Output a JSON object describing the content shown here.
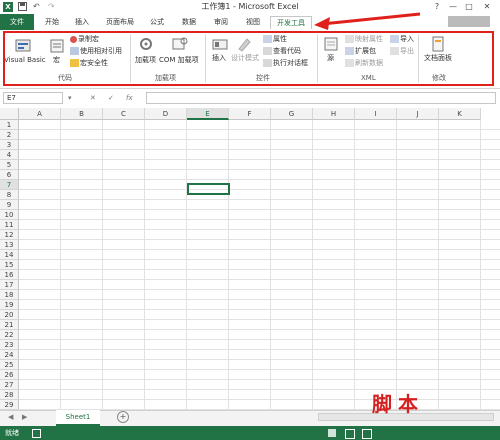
{
  "window": {
    "title": "工作簿1 - Microsoft Excel",
    "logo": "X",
    "minimize": "—",
    "restore": "□",
    "close": "✕",
    "help": "?"
  },
  "qat": {
    "save_icon": "save-icon",
    "undo": "↶",
    "redo": "↷"
  },
  "tabs": [
    "文件",
    "开始",
    "插入",
    "页面布局",
    "公式",
    "数据",
    "审阅",
    "视图",
    "开发工具"
  ],
  "active_tab": "开发工具",
  "ribbon": {
    "groups": [
      {
        "label": "代码",
        "items": [
          "Visual Basic",
          "宏",
          "录制宏",
          "使用相对引用",
          "宏安全性"
        ]
      },
      {
        "label": "加载项",
        "items": [
          "加载项",
          "COM 加载项"
        ]
      },
      {
        "label": "控件",
        "items": [
          "插入",
          "设计模式",
          "属性",
          "查看代码",
          "执行对话框"
        ]
      },
      {
        "label": "XML",
        "items": [
          "源",
          "映射属性",
          "扩展包",
          "刷新数据",
          "导入",
          "导出"
        ]
      },
      {
        "label": "修改",
        "items": [
          "文档面板"
        ]
      }
    ]
  },
  "formula_bar": {
    "name_box": "E7",
    "cancel": "✕",
    "enter": "✓",
    "fx": "fx",
    "value": ""
  },
  "columns": [
    "A",
    "B",
    "C",
    "D",
    "E",
    "F",
    "G",
    "H",
    "I",
    "J",
    "K"
  ],
  "selected_column": "E",
  "rows": [
    "1",
    "2",
    "3",
    "4",
    "5",
    "6",
    "7",
    "8",
    "9",
    "10",
    "11",
    "12",
    "13",
    "14",
    "15",
    "16",
    "17",
    "18",
    "19",
    "20",
    "21",
    "22",
    "23",
    "24",
    "25",
    "26",
    "27",
    "28",
    "29"
  ],
  "selected_row": "7",
  "sheets": {
    "tabs": [
      "Sheet1"
    ],
    "add": "+",
    "prev": "◀",
    "next": "▶"
  },
  "status": {
    "text": "就绪"
  },
  "watermark": "脚本",
  "colors": {
    "excel_green": "#217346",
    "highlight": "#e0201a"
  }
}
